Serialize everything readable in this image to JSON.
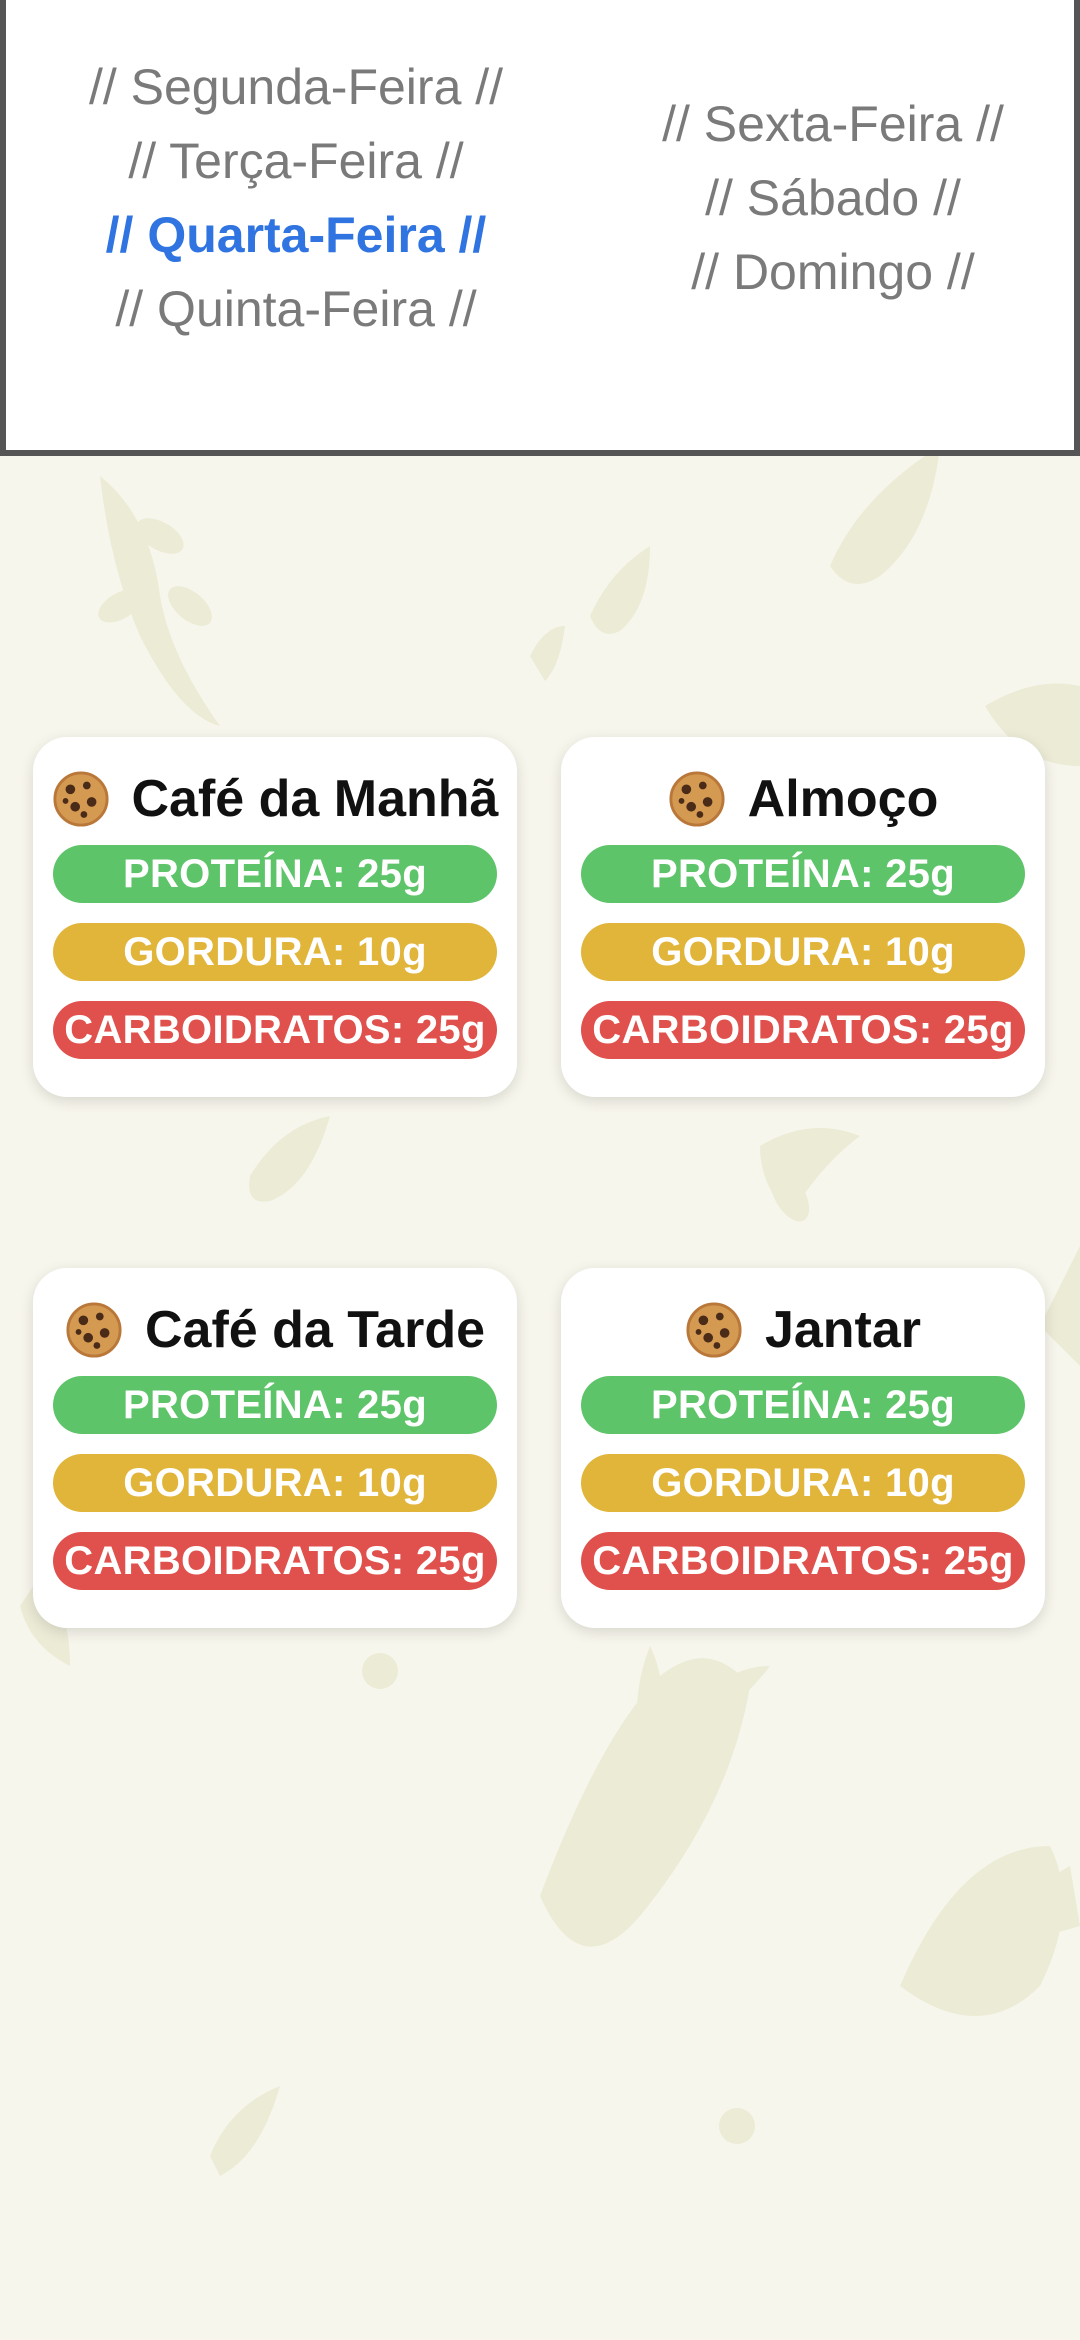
{
  "days": {
    "left": [
      {
        "label": "// Segunda-Feira //",
        "selected": false
      },
      {
        "label": "// Terça-Feira //",
        "selected": false
      },
      {
        "label": "// Quarta-Feira //",
        "selected": true
      },
      {
        "label": "// Quinta-Feira //",
        "selected": false
      }
    ],
    "right": [
      {
        "label": "// Sexta-Feira //",
        "selected": false
      },
      {
        "label": "// Sábado //",
        "selected": false
      },
      {
        "label": "// Domingo //",
        "selected": false
      }
    ]
  },
  "colors": {
    "selected_day": "#2f74e0",
    "protein": "#5ec46a",
    "fat": "#e1b43a",
    "carbs": "#e0504c"
  },
  "meals": [
    {
      "icon": "cookie-icon",
      "title": "Café da Manhã",
      "protein": "PROTEÍNA: 25g",
      "fat": "GORDURA: 10g",
      "carbs": "CARBOIDRATOS: 25g"
    },
    {
      "icon": "cookie-icon",
      "title": "Almoço",
      "protein": "PROTEÍNA: 25g",
      "fat": "GORDURA: 10g",
      "carbs": "CARBOIDRATOS: 25g"
    },
    {
      "icon": "cookie-icon",
      "title": "Café da Tarde",
      "protein": "PROTEÍNA: 25g",
      "fat": "GORDURA: 10g",
      "carbs": "CARBOIDRATOS: 25g"
    },
    {
      "icon": "cookie-icon",
      "title": "Jantar",
      "protein": "PROTEÍNA: 25g",
      "fat": "GORDURA: 10g",
      "carbs": "CARBOIDRATOS: 25g"
    }
  ]
}
